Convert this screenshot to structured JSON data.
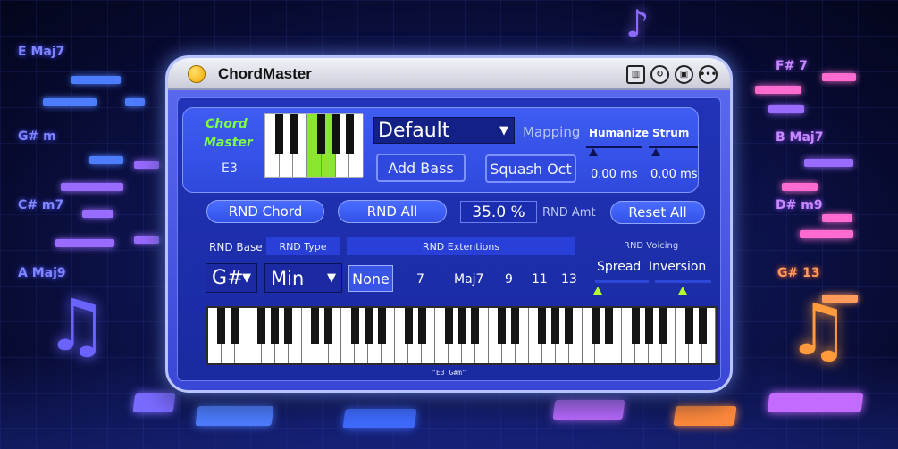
{
  "background": {
    "chords_left": [
      "E Maj7",
      "G# m",
      "C# m7",
      "A Maj9"
    ],
    "chords_right": [
      "F# 7",
      "B Maj7",
      "D# m9",
      "G# 13"
    ]
  },
  "app": {
    "title": "ChordMaster",
    "toolbar_icons": [
      "piano-icon",
      "refresh-icon",
      "save-icon",
      "more-icon"
    ]
  },
  "header": {
    "logo_line1": "Chord",
    "logo_line2": "Master",
    "root_note": "E3",
    "mini_keyboard_lit": [
      3,
      4
    ],
    "preset_value": "Default",
    "mapping_label": "Mapping",
    "add_bass_label": "Add Bass",
    "squash_oct_label": "Squash Oct",
    "humanize_label": "Humanize",
    "humanize_value": "0.00 ms",
    "strum_label": "Strum",
    "strum_value": "0.00 ms"
  },
  "randomize": {
    "rnd_chord_label": "RND Chord",
    "rnd_all_label": "RND All",
    "rnd_amt_value": "35.0 %",
    "rnd_amt_label": "RND Amt",
    "reset_all_label": "Reset All"
  },
  "sections": {
    "rnd_base": "RND Base",
    "rnd_type": "RND Type",
    "rnd_extentions": "RND Extentions",
    "rnd_voicing": "RND Voicing"
  },
  "controls": {
    "base_value": "G#",
    "type_value": "Min",
    "extensions": [
      "None",
      "7",
      "Maj7",
      "9",
      "11",
      "13"
    ],
    "voicing_spread": "Spread",
    "voicing_inversion": "Inversion"
  },
  "keyboard": {
    "status": "\"E3 G#m\""
  },
  "colors": {
    "accent_green": "#7dff4a",
    "panel_blue": "#2133b8",
    "button_blue": "#3352e8"
  }
}
